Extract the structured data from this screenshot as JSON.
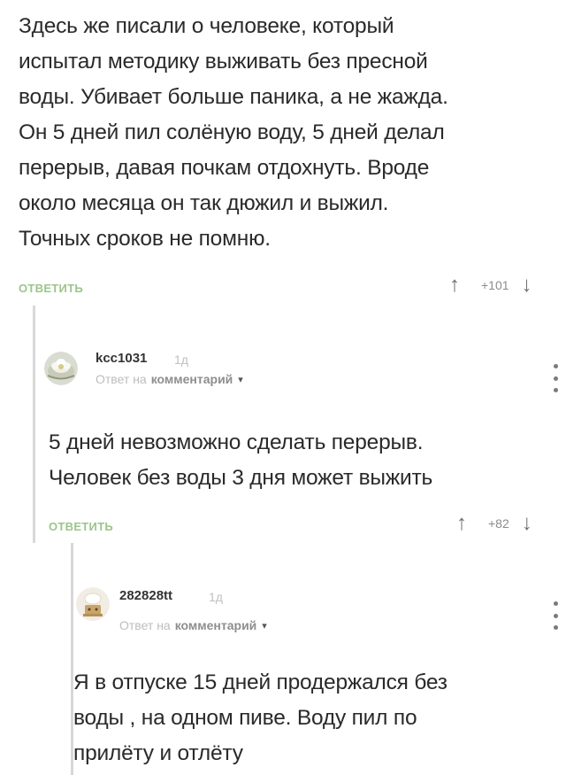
{
  "comments": [
    {
      "text_lines": [
        "Здесь же писали о человеке, который",
        "испытал методику выживать без пресной",
        "воды. Убивает больше паника, а не жажда.",
        "Он 5 дней пил солёную воду, 5 дней делал",
        "перерыв, давая почкам отдохнуть. Вроде",
        "около месяца он так дюжил и выжил.",
        "Точных сроков не помню."
      ],
      "reply_label": "ОТВЕТИТЬ",
      "votes": "+101",
      "upvote_icon": "↑",
      "downvote_icon": "↓"
    },
    {
      "username": "kcc1031",
      "time_ago": "1д",
      "reply_prefix": "Ответ на",
      "reply_target": "комментарий",
      "chevron": "▾",
      "avatar_icon": "flower-avatar-icon",
      "text_lines": [
        "5 дней невозможно сделать перерыв.",
        "Человек без воды 3 дня может выжить"
      ],
      "reply_label": "ОТВЕТИТЬ",
      "votes": "+82",
      "upvote_icon": "↑",
      "downvote_icon": "↓"
    },
    {
      "username": "282828tt",
      "time_ago": "1д",
      "reply_prefix": "Ответ на",
      "reply_target": "комментарий",
      "chevron": "▾",
      "avatar_icon": "chef-avatar-icon",
      "text_lines": [
        "Я в отпуске 15 дней продержался без",
        "воды , на одном пиве. Воду пил по",
        "прилёту и отлёту"
      ]
    }
  ],
  "colors": {
    "reply_link": "#9bc58a",
    "thread_line": "#d8d8d8",
    "text": "#2a2a2a",
    "muted": "#bdbdbd"
  }
}
